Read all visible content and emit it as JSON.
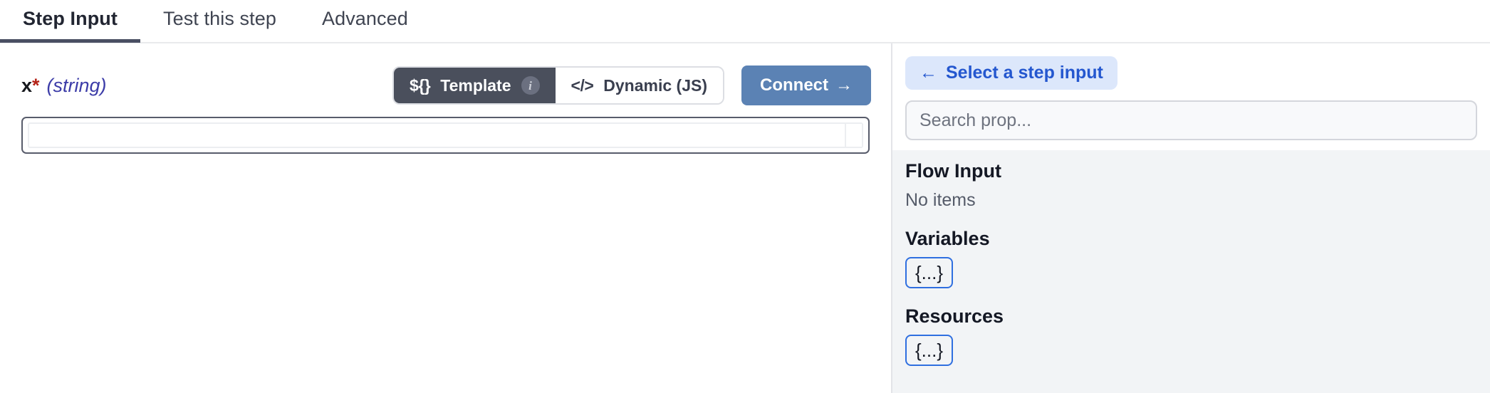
{
  "tabs": [
    {
      "label": "Step Input",
      "active": true
    },
    {
      "label": "Test this step",
      "active": false
    },
    {
      "label": "Advanced",
      "active": false
    }
  ],
  "step_input": {
    "field": {
      "name": "x",
      "required_marker": "*",
      "type": "(string)"
    },
    "mode_toggle": {
      "template": {
        "glyph": "${}",
        "label": "Template",
        "info_glyph": "i",
        "selected": true
      },
      "dynamic": {
        "glyph": "</>",
        "label": "Dynamic (JS)",
        "selected": false
      }
    },
    "connect_button": {
      "label": "Connect",
      "arrow": "→"
    },
    "editor": {
      "value": "",
      "placeholder": ""
    }
  },
  "picker": {
    "back_button": {
      "arrow": "←",
      "label": "Select a step input"
    },
    "search": {
      "value": "",
      "placeholder": "Search prop..."
    },
    "sections": [
      {
        "title": "Flow Input",
        "empty_text": "No items",
        "chip": null
      },
      {
        "title": "Variables",
        "empty_text": null,
        "chip": "{...}"
      },
      {
        "title": "Resources",
        "empty_text": null,
        "chip": "{...}"
      }
    ]
  },
  "colors": {
    "accent_blue": "#2457cf",
    "connect_blue": "#5b82b4",
    "toggle_dark": "#4a4f5c",
    "required_red": "#b42318",
    "type_indigo": "#3c3ca8",
    "panel_bg": "#f2f4f6",
    "chip_border": "#2f6fe0"
  }
}
